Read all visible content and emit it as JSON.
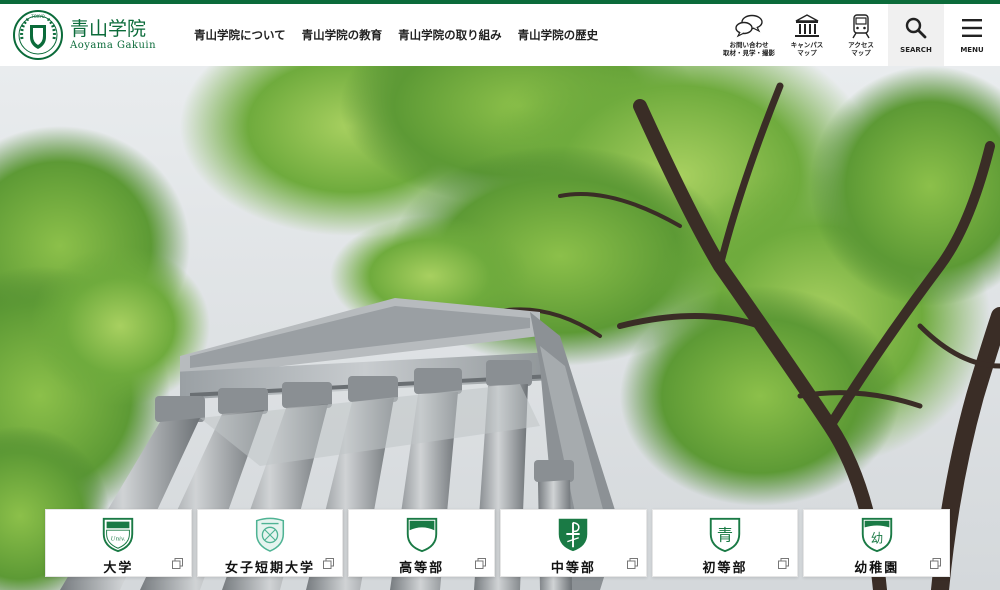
{
  "header": {
    "logo": {
      "jp": "青山学院",
      "en": "Aoyama Gakuin",
      "seal_text": "TOKYO"
    },
    "nav": [
      {
        "label": "青山学院について"
      },
      {
        "label": "青山学院の教育"
      },
      {
        "label": "青山学院の取り組み"
      },
      {
        "label": "青山学院の歴史"
      }
    ],
    "tools": {
      "contact": {
        "line1": "お問い合わせ",
        "line2": "取材・見学・撮影",
        "icon": "speech-bubbles-icon"
      },
      "campus": {
        "line1": "キャンパス",
        "line2": "マップ",
        "icon": "building-icon"
      },
      "access": {
        "line1": "アクセス",
        "line2": "マップ",
        "icon": "train-icon"
      },
      "search": {
        "label": "SEARCH",
        "icon": "search-icon"
      },
      "menu": {
        "label": "MENU",
        "icon": "hamburger-icon"
      }
    }
  },
  "schools": [
    {
      "name": "大学",
      "crest_text": "Univ."
    },
    {
      "name": "女子短期大学",
      "crest_text": ""
    },
    {
      "name": "高等部",
      "crest_text": ""
    },
    {
      "name": "中等部",
      "crest_text": ""
    },
    {
      "name": "初等部",
      "crest_text": "青"
    },
    {
      "name": "幼稚園",
      "crest_text": "幼"
    }
  ],
  "colors": {
    "brand_green": "#0b6b3a",
    "crest_green": "#1a7a45"
  }
}
